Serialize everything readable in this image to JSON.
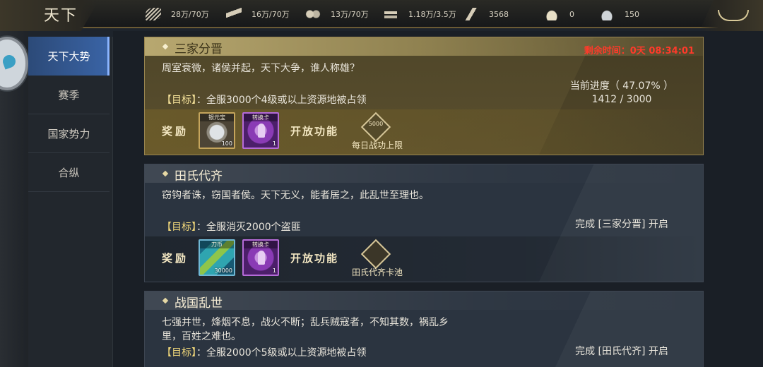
{
  "topbar": {
    "logo_text": "天下",
    "resources": [
      {
        "icon": "grain-icon",
        "value": "28万/70万"
      },
      {
        "icon": "wood-icon",
        "value": "16万/70万"
      },
      {
        "icon": "stone-icon",
        "value": "13万/70万"
      },
      {
        "icon": "iron-icon",
        "value": "1.18万/3.5万"
      },
      {
        "icon": "merit-icon",
        "value": "3568"
      },
      {
        "icon": "gold-ingot-icon",
        "value": "0"
      },
      {
        "icon": "silver-ingot-icon",
        "value": "150"
      }
    ]
  },
  "sidebar": {
    "items": [
      {
        "label": "天下大势",
        "active": true
      },
      {
        "label": "赛季",
        "active": false
      },
      {
        "label": "国家势力",
        "active": false
      },
      {
        "label": "合纵",
        "active": false
      }
    ]
  },
  "cards": [
    {
      "title": "三家分晋",
      "description": "周室衰微，诸侯并起，天下大争，谁人称雄？",
      "goal_bracket": "【目标】",
      "goal_text": "：全服3000个4级或以上资源地被占领",
      "remaining": "剩余时间：0天 08:34:01",
      "progress_label": "当前进度（ 47.07% ）",
      "progress_fraction": "1412 / 3000",
      "progress_percent": 47.07,
      "reward_label": "奖励",
      "open_label": "开放功能",
      "rewards": [
        {
          "name": "银元宝",
          "count": "100",
          "icon": "silver-ingot-icon"
        },
        {
          "name": "转换卡",
          "count": "1",
          "icon": "conversion-card-icon"
        }
      ],
      "feature_label": "每日战功上限",
      "feature_icon_text": "5000"
    },
    {
      "title": "田氏代齐",
      "description": "窃钩者诛，窃国者侯。天下无义，能者居之，此乱世至理也。",
      "goal_bracket": "【目标】",
      "goal_text": "：全服消灭2000个盗匪",
      "status": "完成 [三家分晋] 开启",
      "reward_label": "奖励",
      "open_label": "开放功能",
      "rewards": [
        {
          "name": "刀币",
          "count": "30000",
          "icon": "knife-coin-icon"
        },
        {
          "name": "转换卡",
          "count": "1",
          "icon": "conversion-card-icon"
        }
      ],
      "feature_label": "田氏代齐卡池"
    },
    {
      "title": "战国乱世",
      "description": "七强并世，烽烟不息，战火不断；乱兵贼寇者，不知其数，祸乱乡里，百姓之难也。",
      "goal_bracket": "【目标】",
      "goal_text": "：全服2000个5级或以上资源地被占领",
      "status": "完成 [田氏代齐] 开启"
    }
  ]
}
